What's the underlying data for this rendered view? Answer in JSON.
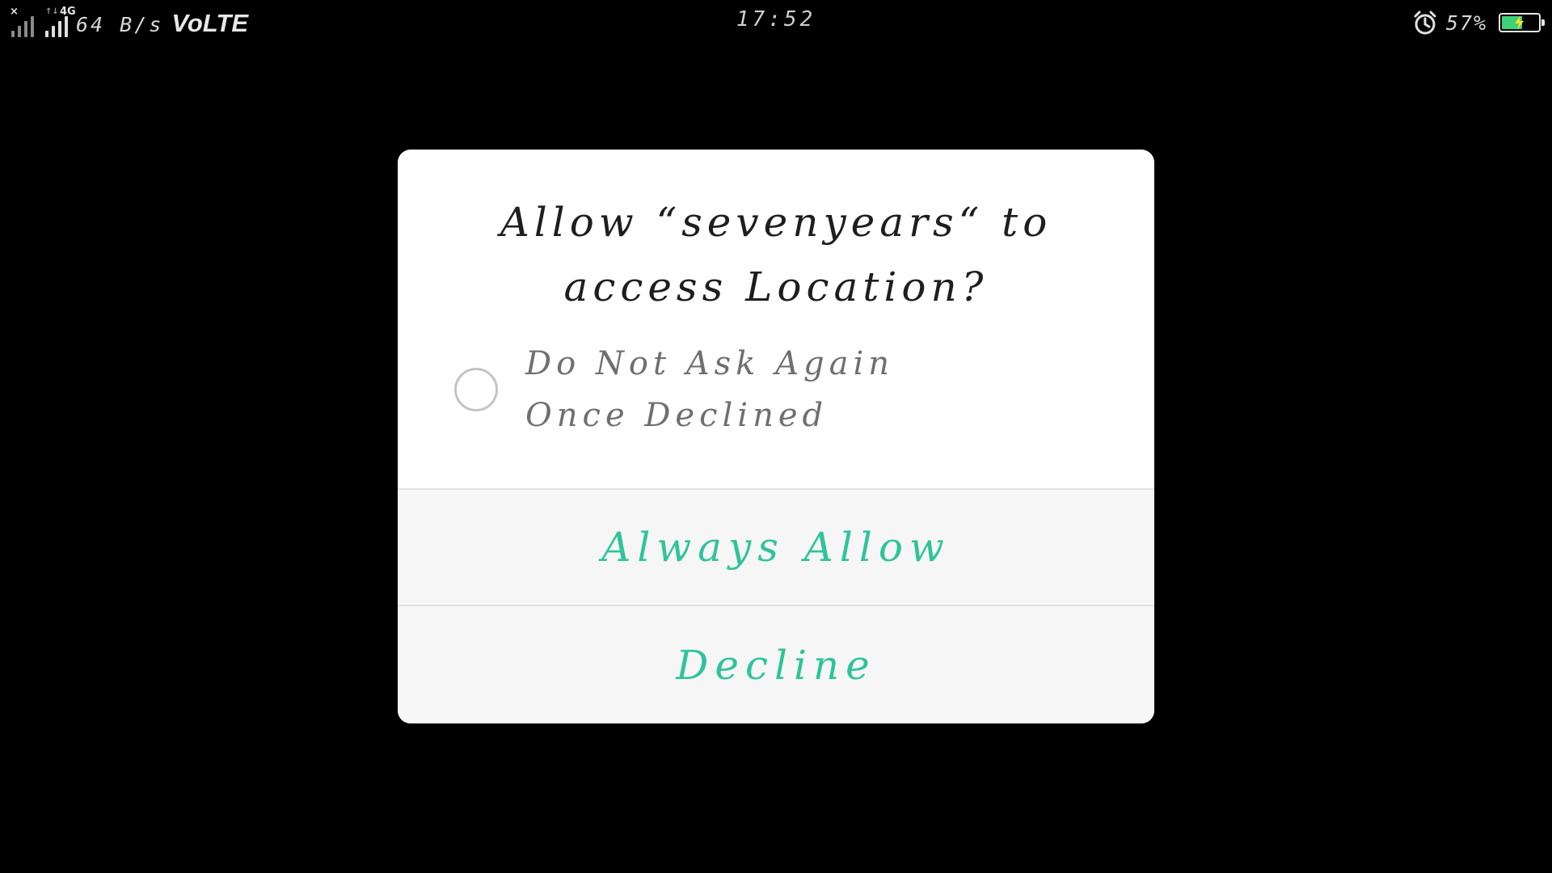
{
  "status_bar": {
    "signal_1_tag": "×",
    "signal_2_tag_small": "↑↓",
    "signal_2_tag": "4G",
    "network_speed": "64 B/s",
    "volte": "VoLTE",
    "time": "17:52",
    "alarm_icon": "alarm-clock-icon",
    "battery_percent": "57%",
    "battery_level": 0.57,
    "charging_color": "#3bd27a"
  },
  "dialog": {
    "title": "Allow “sevenyears“ to access Location?",
    "do_not_ask_label": "Do Not Ask Again Once Declined",
    "do_not_ask_checked": false,
    "always_allow_label": "Always Allow",
    "decline_label": "Decline",
    "accent_color": "#2fc49a"
  }
}
